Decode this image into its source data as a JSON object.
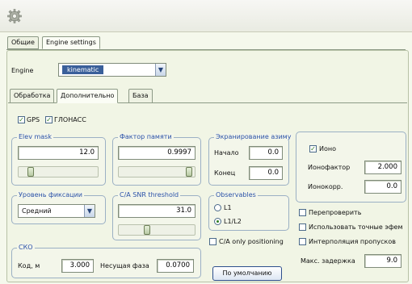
{
  "tabs_top": [
    "Общие",
    "Engine settings"
  ],
  "engine": {
    "label": "Engine",
    "value": "kinematic"
  },
  "tabs_sub": [
    "Обработка",
    "Дополнительно",
    "База"
  ],
  "systems": {
    "gps": "GPS",
    "glonass": "ГЛОНАСС"
  },
  "elev_mask": {
    "title": "Elev mask",
    "value": "12.0",
    "slider_fraction": 0.12
  },
  "memory_factor": {
    "title": "Фактор памяти",
    "value": "0.9997",
    "slider_fraction": 0.97
  },
  "screening": {
    "title": "Экранирование азиму",
    "start_label": "Начало",
    "start_value": "0.0",
    "end_label": "Конец",
    "end_value": "0.0"
  },
  "iono": {
    "check_label": "Ионо",
    "factor_label": "Ионофактор",
    "factor_value": "2.000",
    "corr_label": "Ионокорр.",
    "corr_value": "0.0"
  },
  "fix_level": {
    "title": "Уровень фиксации",
    "value": "Средний"
  },
  "ca_snr": {
    "title": "C/A SNR threshold",
    "value": "31.0",
    "slider_fraction": 0.36
  },
  "observables": {
    "title": "Observables",
    "opt1": "L1",
    "opt2": "L1/L2",
    "selected": "L1/L2"
  },
  "options": {
    "recheck": "Перепроверить",
    "exact_ephem": "Использовать точные эфем",
    "interp": "Интерполяция пропусков",
    "max_delay_label": "Макс. задержка",
    "max_delay_value": "9.0"
  },
  "ca_only": "C/A only positioning",
  "sko": {
    "title": "СКО",
    "code_label": "Код, м",
    "code_value": "3.000",
    "carrier_label": "Несущая фаза",
    "carrier_value": "0.0700"
  },
  "default_button": "По умолчанию",
  "colors": {
    "accent": "#2b52a8",
    "check": "#2f7d22",
    "background": "#f5f8ec"
  }
}
